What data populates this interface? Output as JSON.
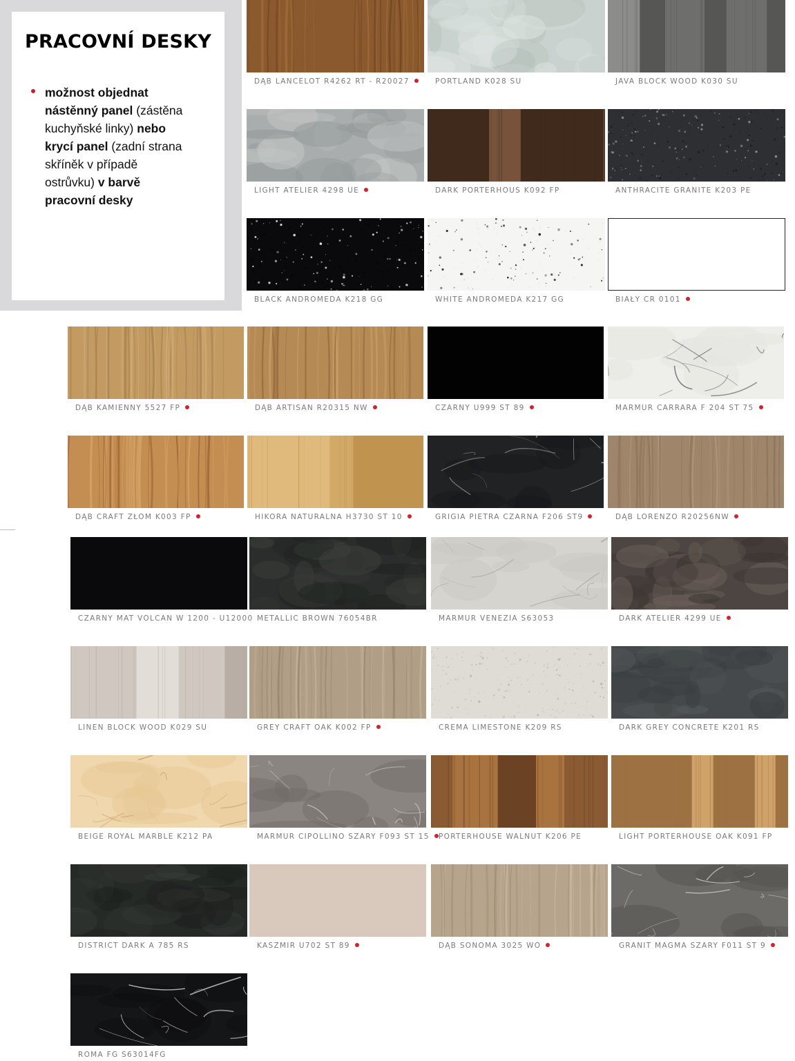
{
  "info": {
    "title": "PRACOVNÍ DESKY",
    "note_lines": [
      [
        {
          "b": true,
          "t": "možnost objednat"
        }
      ],
      [
        {
          "b": true,
          "t": "nástěnný panel"
        },
        {
          "b": false,
          "t": " (zástěna"
        }
      ],
      [
        {
          "b": false,
          "t": " kuchyňské linky) "
        },
        {
          "b": true,
          "t": "nebo"
        }
      ],
      [
        {
          "b": true,
          "t": "krycí panel"
        },
        {
          "b": false,
          "t": " (zadní strana"
        }
      ],
      [
        {
          "b": false,
          "t": "skříněk v případě"
        }
      ],
      [
        {
          "b": false,
          "t": "ostrůvku) "
        },
        {
          "b": true,
          "t": "v barvě"
        }
      ],
      [
        {
          "b": true,
          "t": "pracovní desky"
        }
      ]
    ],
    "bullet_color": "#c8202a"
  },
  "dot_color": "#d2232a",
  "swatches": [
    {
      "name": "DĄB LANCELOT R4262 RT - R20027",
      "dot": true,
      "texture": "wood",
      "colors": [
        "#8a5a2e",
        "#6f4520",
        "#a06b38"
      ]
    },
    {
      "name": "PORTLAND K028 SU",
      "dot": false,
      "texture": "concrete",
      "colors": [
        "#c9d2ce",
        "#b5c0bb",
        "#dde3e0"
      ]
    },
    {
      "name": "JAVA BLOCK WOOD K030 SU",
      "dot": false,
      "texture": "planks",
      "colors": [
        "#6e6f6d",
        "#565755",
        "#8c8d8a"
      ]
    },
    {
      "name": "LIGHT ATELIER 4298 UE",
      "dot": true,
      "texture": "concrete",
      "colors": [
        "#a9adad",
        "#959a9b",
        "#c2c5c4"
      ]
    },
    {
      "name": "DARK PORTERHOUS K092 FP",
      "dot": false,
      "texture": "planks",
      "colors": [
        "#5a3d2a",
        "#3f2a1c",
        "#76533a"
      ]
    },
    {
      "name": "ANTHRACITE GRANITE K203 PE",
      "dot": false,
      "texture": "speckle",
      "colors": [
        "#2e2f33",
        "#1d1e21",
        "#8a8b8e"
      ]
    },
    {
      "name": "BLACK ANDROMEDA K218 GG",
      "dot": false,
      "texture": "speckle",
      "colors": [
        "#0a0a0c",
        "#050506",
        "#d9d9d9"
      ]
    },
    {
      "name": "WHITE ANDROMEDA K217 GG",
      "dot": false,
      "texture": "speckle",
      "colors": [
        "#f5f5f3",
        "#eeeeec",
        "#222222"
      ]
    },
    {
      "name": "BIAŁY CR 0101",
      "dot": true,
      "texture": "plain-border",
      "colors": [
        "#ffffff",
        "#ffffff",
        "#222222"
      ]
    },
    {
      "name": "DĄB KAMIENNY 5527 FP",
      "dot": true,
      "texture": "wood",
      "colors": [
        "#c29a62",
        "#a88350",
        "#d3ad78"
      ]
    },
    {
      "name": "DĄB ARTISAN R20315 NW",
      "dot": true,
      "texture": "wood",
      "colors": [
        "#b58a55",
        "#94693a",
        "#c99e68"
      ]
    },
    {
      "name": "CZARNY U999 ST 89",
      "dot": true,
      "texture": "plain",
      "colors": [
        "#020202",
        "#020202",
        "#020202"
      ]
    },
    {
      "name": "MARMUR CARRARA F 204 ST 75",
      "dot": true,
      "texture": "marble",
      "colors": [
        "#eeeeea",
        "#e4e4e0",
        "#7b7f85"
      ]
    },
    {
      "name": "DĄB CRAFT ZŁOM K003 FP",
      "dot": true,
      "texture": "wood",
      "colors": [
        "#c48d52",
        "#9c6634",
        "#d7a469"
      ]
    },
    {
      "name": "HIKORA NATURALNA H3730 ST 10",
      "dot": true,
      "texture": "planks",
      "colors": [
        "#d3a968",
        "#c0944f",
        "#e0b97c"
      ]
    },
    {
      "name": "GRIGIA PIETRA CZARNA F206 ST9",
      "dot": true,
      "texture": "marble",
      "colors": [
        "#202223",
        "#17181a",
        "#9a9c9e"
      ]
    },
    {
      "name": "DĄB LORENZO R20256NW",
      "dot": true,
      "texture": "wood",
      "colors": [
        "#9f866a",
        "#8a7258",
        "#b09679"
      ]
    },
    {
      "name": "CZARNY MAT VOLCAN W 1200 - U12000",
      "dot": false,
      "texture": "plain",
      "colors": [
        "#0a0a0c",
        "#060608",
        "#141416"
      ]
    },
    {
      "name": "METALLIC BROWN 76054BR",
      "dot": false,
      "texture": "concrete",
      "colors": [
        "#2a2d2b",
        "#1f2220",
        "#3a3d3a"
      ]
    },
    {
      "name": "MARMUR VENEZIA S63053",
      "dot": false,
      "texture": "marble",
      "colors": [
        "#d6d4cf",
        "#cac7c1",
        "#a9a6a0"
      ]
    },
    {
      "name": "DARK ATELIER 4299 UE",
      "dot": true,
      "texture": "concrete",
      "colors": [
        "#4d4541",
        "#3b3431",
        "#6a5f59"
      ]
    },
    {
      "name": "LINEN BLOCK WOOD K029 SU",
      "dot": false,
      "texture": "planks",
      "colors": [
        "#cfc7c0",
        "#b8aea6",
        "#e3ddd7"
      ]
    },
    {
      "name": "GREY CRAFT OAK K002 FP",
      "dot": true,
      "texture": "wood",
      "colors": [
        "#b19e86",
        "#9a8770",
        "#c4b29b"
      ]
    },
    {
      "name": "CREMA LIMESTONE K209 RS",
      "dot": false,
      "texture": "speckle",
      "colors": [
        "#dedcd5",
        "#d2cfc7",
        "#bdb9b0"
      ]
    },
    {
      "name": "DARK GREY CONCRETE K201 RS",
      "dot": false,
      "texture": "concrete",
      "colors": [
        "#45494b",
        "#3a3e40",
        "#54585a"
      ]
    },
    {
      "name": "BEIGE ROYAL MARBLE K212 PA",
      "dot": false,
      "texture": "marble",
      "colors": [
        "#f0d7ad",
        "#e6c795",
        "#caa77a"
      ]
    },
    {
      "name": "MARMUR CIPOLLINO SZARY F093 ST 15",
      "dot": true,
      "texture": "marble",
      "colors": [
        "#8a8581",
        "#6f6a66",
        "#c2bcb6"
      ]
    },
    {
      "name": "PORTERHOUSE WALNUT K206 PE",
      "dot": false,
      "texture": "planks",
      "colors": [
        "#8a5a33",
        "#6b4224",
        "#a8733f"
      ]
    },
    {
      "name": "LIGHT PORTERHOUSE OAK K091 FP",
      "dot": false,
      "texture": "planks",
      "colors": [
        "#b88a55",
        "#9d7142",
        "#cfa26a"
      ]
    },
    {
      "name": "DISTRICT DARK A 785 RS",
      "dot": false,
      "texture": "concrete",
      "colors": [
        "#262a27",
        "#1c1f1d",
        "#363a37"
      ]
    },
    {
      "name": "KASZMIR U702 ST 89",
      "dot": true,
      "texture": "plain",
      "colors": [
        "#d8c9bc",
        "#d8c9bc",
        "#d8c9bc"
      ]
    },
    {
      "name": "DĄB SONOMA 3025 WO",
      "dot": true,
      "texture": "wood",
      "colors": [
        "#b6a48c",
        "#a08d74",
        "#c9b9a2"
      ]
    },
    {
      "name": "GRANIT MAGMA SZARY F011 ST 9",
      "dot": true,
      "texture": "marble",
      "colors": [
        "#6c6b67",
        "#54534f",
        "#c9c7c2"
      ]
    },
    {
      "name": "ROMA FG S63014FG",
      "dot": false,
      "texture": "marble",
      "colors": [
        "#141618",
        "#0d0e10",
        "#c8c8c8"
      ]
    }
  ]
}
